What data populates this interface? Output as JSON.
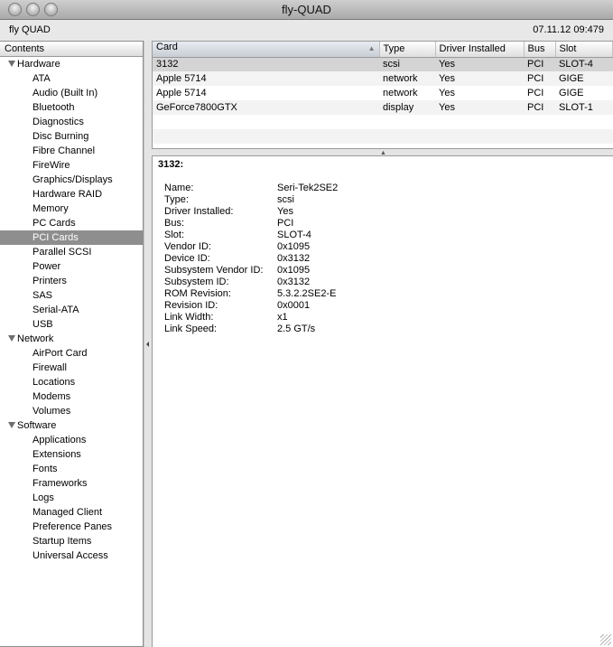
{
  "window": {
    "title": "fly-QUAD",
    "buttons": [
      "close",
      "minimize",
      "zoom"
    ]
  },
  "infobar": {
    "machine_name": "fly QUAD",
    "datetime": "07.11.12 09:479"
  },
  "sidebar": {
    "header": "Contents",
    "groups": [
      {
        "label": "Hardware",
        "items": [
          "ATA",
          "Audio (Built In)",
          "Bluetooth",
          "Diagnostics",
          "Disc Burning",
          "Fibre Channel",
          "FireWire",
          "Graphics/Displays",
          "Hardware RAID",
          "Memory",
          "PC Cards",
          "PCI Cards",
          "Parallel SCSI",
          "Power",
          "Printers",
          "SAS",
          "Serial-ATA",
          "USB"
        ]
      },
      {
        "label": "Network",
        "items": [
          "AirPort Card",
          "Firewall",
          "Locations",
          "Modems",
          "Volumes"
        ]
      },
      {
        "label": "Software",
        "items": [
          "Applications",
          "Extensions",
          "Fonts",
          "Frameworks",
          "Logs",
          "Managed Client",
          "Preference Panes",
          "Startup Items",
          "Universal Access"
        ]
      }
    ],
    "selected": "PCI Cards"
  },
  "table": {
    "columns": [
      "Card",
      "Type",
      "Driver Installed",
      "Bus",
      "Slot"
    ],
    "sorted_column": "Card",
    "rows": [
      [
        "3132",
        "scsi",
        "Yes",
        "PCI",
        "SLOT-4"
      ],
      [
        "Apple 5714",
        "network",
        "Yes",
        "PCI",
        "GIGE"
      ],
      [
        "Apple 5714",
        "network",
        "Yes",
        "PCI",
        "GIGE"
      ],
      [
        "GeForce7800GTX",
        "display",
        "Yes",
        "PCI",
        "SLOT-1"
      ]
    ],
    "selected_row": 0
  },
  "detail": {
    "title": "3132:",
    "properties": [
      {
        "key": "Name:",
        "value": "Seri-Tek2SE2"
      },
      {
        "key": "Type:",
        "value": "scsi"
      },
      {
        "key": "Driver Installed:",
        "value": "Yes"
      },
      {
        "key": "Bus:",
        "value": "PCI"
      },
      {
        "key": "Slot:",
        "value": "SLOT-4"
      },
      {
        "key": "Vendor ID:",
        "value": "0x1095"
      },
      {
        "key": "Device ID:",
        "value": "0x3132"
      },
      {
        "key": "Subsystem Vendor ID:",
        "value": "0x1095"
      },
      {
        "key": "Subsystem ID:",
        "value": "0x3132"
      },
      {
        "key": "ROM Revision:",
        "value": "5.3.2.2SE2-E"
      },
      {
        "key": "Revision ID:",
        "value": "0x0001"
      },
      {
        "key": "Link Width:",
        "value": "x1"
      },
      {
        "key": "Link Speed:",
        "value": "2.5 GT/s"
      }
    ]
  }
}
